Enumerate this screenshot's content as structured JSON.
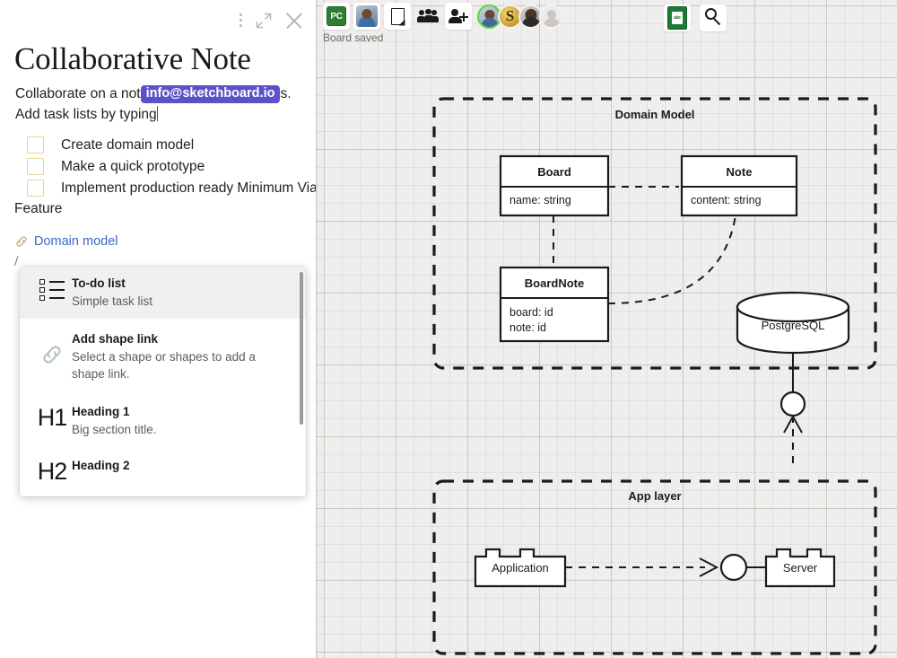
{
  "note": {
    "title": "Collaborative Note",
    "paragraph_before_mention": "Collaborate on a not",
    "mention": "info@sketchboard.io",
    "paragraph_after_mention": "s.",
    "paragraph_line2": "Add task lists by typing",
    "tasks": [
      {
        "label": "Create domain model",
        "checked": false
      },
      {
        "label": "Make a quick prototype",
        "checked": false
      },
      {
        "label": "Implement production ready Minimum Viable",
        "checked": false
      }
    ],
    "task_overflow_text": "Feature",
    "shape_link_label": "Domain model",
    "slash_text": "/",
    "actions": {
      "more_label": "More options",
      "expand_label": "Expand",
      "close_label": "Close"
    }
  },
  "slash_menu": {
    "items": [
      {
        "icon": "todo-list-icon",
        "title": "To-do list",
        "desc": "Simple task list",
        "selected": true
      },
      {
        "icon": "link-icon",
        "title": "Add shape link",
        "desc": "Select a shape or shapes to add a shape link.",
        "selected": false
      },
      {
        "icon": "H1",
        "title": "Heading 1",
        "desc": "Big section title.",
        "selected": false
      },
      {
        "icon": "H2",
        "title": "Heading 2",
        "desc": "",
        "selected": false
      }
    ]
  },
  "toolbar": {
    "brand_badge": "PC",
    "buttons": [
      {
        "name": "brand-badge",
        "label": "PC"
      },
      {
        "name": "user-avatar-button",
        "label": "User avatar"
      },
      {
        "name": "note-button",
        "label": "Note"
      },
      {
        "name": "team-button",
        "label": "Team"
      },
      {
        "name": "invite-user-button",
        "label": "Invite user"
      }
    ],
    "collaborators": [
      {
        "name": "collaborator-1",
        "active": true
      },
      {
        "name": "collaborator-2",
        "active": false
      },
      {
        "name": "collaborator-3",
        "active": false
      },
      {
        "name": "collaborator-4",
        "active": false
      }
    ],
    "right_buttons": [
      {
        "name": "export-button",
        "label": "Export"
      },
      {
        "name": "zoom-button",
        "label": "Zoom"
      }
    ],
    "status_text": "Board saved",
    "export_glyph": "abc"
  },
  "colors": {
    "brand_green": "#2f7d32",
    "mention_purple": "#5b52c9",
    "link_blue": "#3c66c4",
    "checkbox_border": "#e8d49a",
    "canvas_bg": "#efeeec",
    "stroke": "#1b1b1b"
  },
  "diagram": {
    "groups": [
      {
        "name": "domain-model-group",
        "label": "Domain Model"
      },
      {
        "name": "app-layer-group",
        "label": "App layer"
      }
    ],
    "classes": [
      {
        "name": "class-board",
        "title": "Board",
        "attributes": [
          "name: string"
        ]
      },
      {
        "name": "class-note",
        "title": "Note",
        "attributes": [
          "content: string"
        ]
      },
      {
        "name": "class-boardnote",
        "title": "BoardNote",
        "attributes": [
          "board: id",
          "note: id"
        ]
      }
    ],
    "database": {
      "name": "database-postgresql",
      "label": "PostgreSQL"
    },
    "components": [
      {
        "name": "component-application",
        "label": "Application"
      },
      {
        "name": "component-server",
        "label": "Server"
      }
    ]
  }
}
